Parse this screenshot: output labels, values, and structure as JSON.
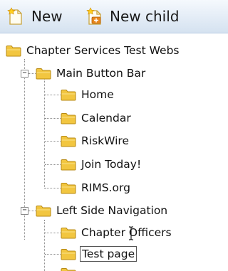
{
  "toolbar": {
    "new_label": "New",
    "new_child_label": "New child"
  },
  "tree": {
    "root": "Chapter Services Test Webs",
    "main_button_bar": {
      "label": "Main Button Bar",
      "items": [
        "Home",
        "Calendar",
        "RiskWire",
        "Join Today!",
        "RIMS.org"
      ]
    },
    "left_side_navigation": {
      "label": "Left Side Navigation",
      "items": [
        "Chapter Officers",
        "Test page"
      ]
    },
    "collapse_glyph": "−"
  },
  "colors": {
    "folder_fill": "#f2c640",
    "folder_stroke": "#b88a12",
    "toolbar_bg": "#e3ecf6"
  }
}
